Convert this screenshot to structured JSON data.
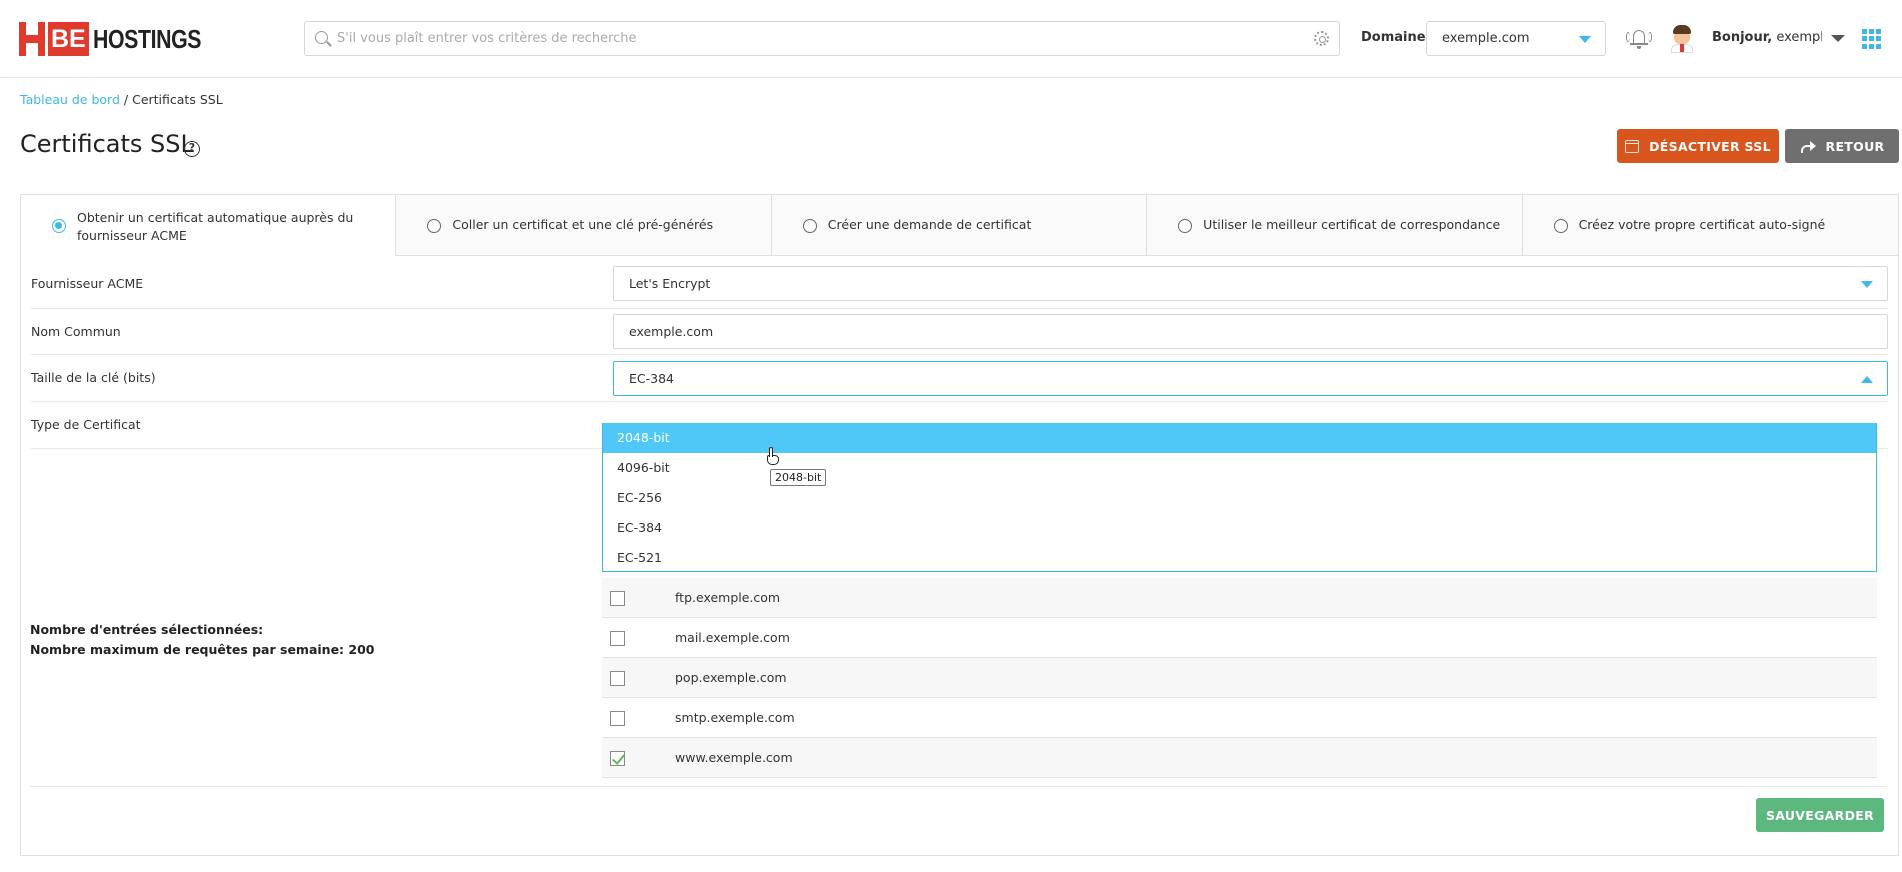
{
  "brand": {
    "logo_be": "BE",
    "logo_text": "HOSTINGS"
  },
  "header": {
    "search_placeholder": "S'il vous plaît entrer vos critères de recherche",
    "domain_label": "Domaine",
    "domain_value": "exemple.com",
    "greeting_bold": "Bonjour,",
    "greeting_user": " exemplec"
  },
  "breadcrumb": {
    "home": "Tableau de bord",
    "separator": " / ",
    "current": "Certificats SSL"
  },
  "page": {
    "title": "Certificats SSL",
    "help": "?",
    "disable_ssl_label": "DÉSACTIVER SSL",
    "back_label": "RETOUR"
  },
  "tabs": [
    {
      "label": "Obtenir un certificat automatique auprès du fournisseur ACME",
      "active": true
    },
    {
      "label": "Coller un certificat et une clé pré-générés",
      "active": false
    },
    {
      "label": "Créer une demande de certificat",
      "active": false
    },
    {
      "label": "Utiliser le meilleur certificat de correspondance",
      "active": false
    },
    {
      "label": "Créez votre propre certificat auto-signé",
      "active": false
    }
  ],
  "form": {
    "acme_label": "Fournisseur ACME",
    "acme_value": "Let's Encrypt",
    "common_name_label": "Nom Commun",
    "common_name_value": "exemple.com",
    "key_size_label": "Taille de la clé (bits)",
    "key_size_value": "EC-384",
    "cert_type_label": "Type de Certificat",
    "key_size_options": [
      "2048-bit",
      "4096-bit",
      "EC-256",
      "EC-384",
      "EC-521"
    ],
    "highlighted_option": "2048-bit",
    "tooltip": "2048-bit"
  },
  "info": {
    "selected_entries": "Nombre d'entrées sélectionnées:",
    "max_requests": "Nombre maximum de requêtes par semaine: 200"
  },
  "subdomains": [
    {
      "host": "ftp.exemple.com",
      "checked": false
    },
    {
      "host": "mail.exemple.com",
      "checked": false
    },
    {
      "host": "pop.exemple.com",
      "checked": false
    },
    {
      "host": "smtp.exemple.com",
      "checked": false
    },
    {
      "host": "www.exemple.com",
      "checked": true
    }
  ],
  "save_label": "SAUVEGARDER",
  "colors": {
    "accent": "#3db8e8",
    "danger": "#d9551e",
    "neutral": "#6f6f6f",
    "success": "#5cb87e"
  }
}
